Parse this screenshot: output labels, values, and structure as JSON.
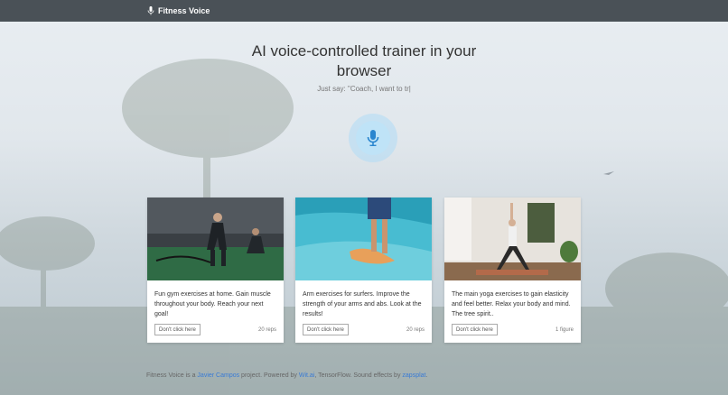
{
  "header": {
    "brand": "Fitness Voice",
    "brand_icon": "mic-icon"
  },
  "hero": {
    "title": "AI voice-controlled trainer in your browser",
    "subtitle": "Just say: \"Coach, I want to tr|"
  },
  "cards": [
    {
      "text": "Fun gym exercises at home. Gain muscle throughout your body. Reach your next goal!",
      "button": "Don't click here",
      "meta": "20 reps"
    },
    {
      "text": "Arm exercises for surfers. Improve the strength of your arms and abs. Look at the results!",
      "button": "Don't click here",
      "meta": "20 reps"
    },
    {
      "text": "The main yoga exercises to gain elasticity and feel better. Relax your body and mind. The tree spirit..",
      "button": "Don't click here",
      "meta": "1 figure"
    }
  ],
  "footer": {
    "t1": "Fitness Voice is a ",
    "author": "Javier Campos",
    "t2": " project. Powered by ",
    "lib1": "Wit.ai",
    "t3": ", TensorFlow. Sound effects by ",
    "lib2": "zapsplat",
    "t4": "."
  },
  "colors": {
    "topbar": "#4a5157",
    "mic": "#2b86cf",
    "link": "#3a7bd5"
  }
}
